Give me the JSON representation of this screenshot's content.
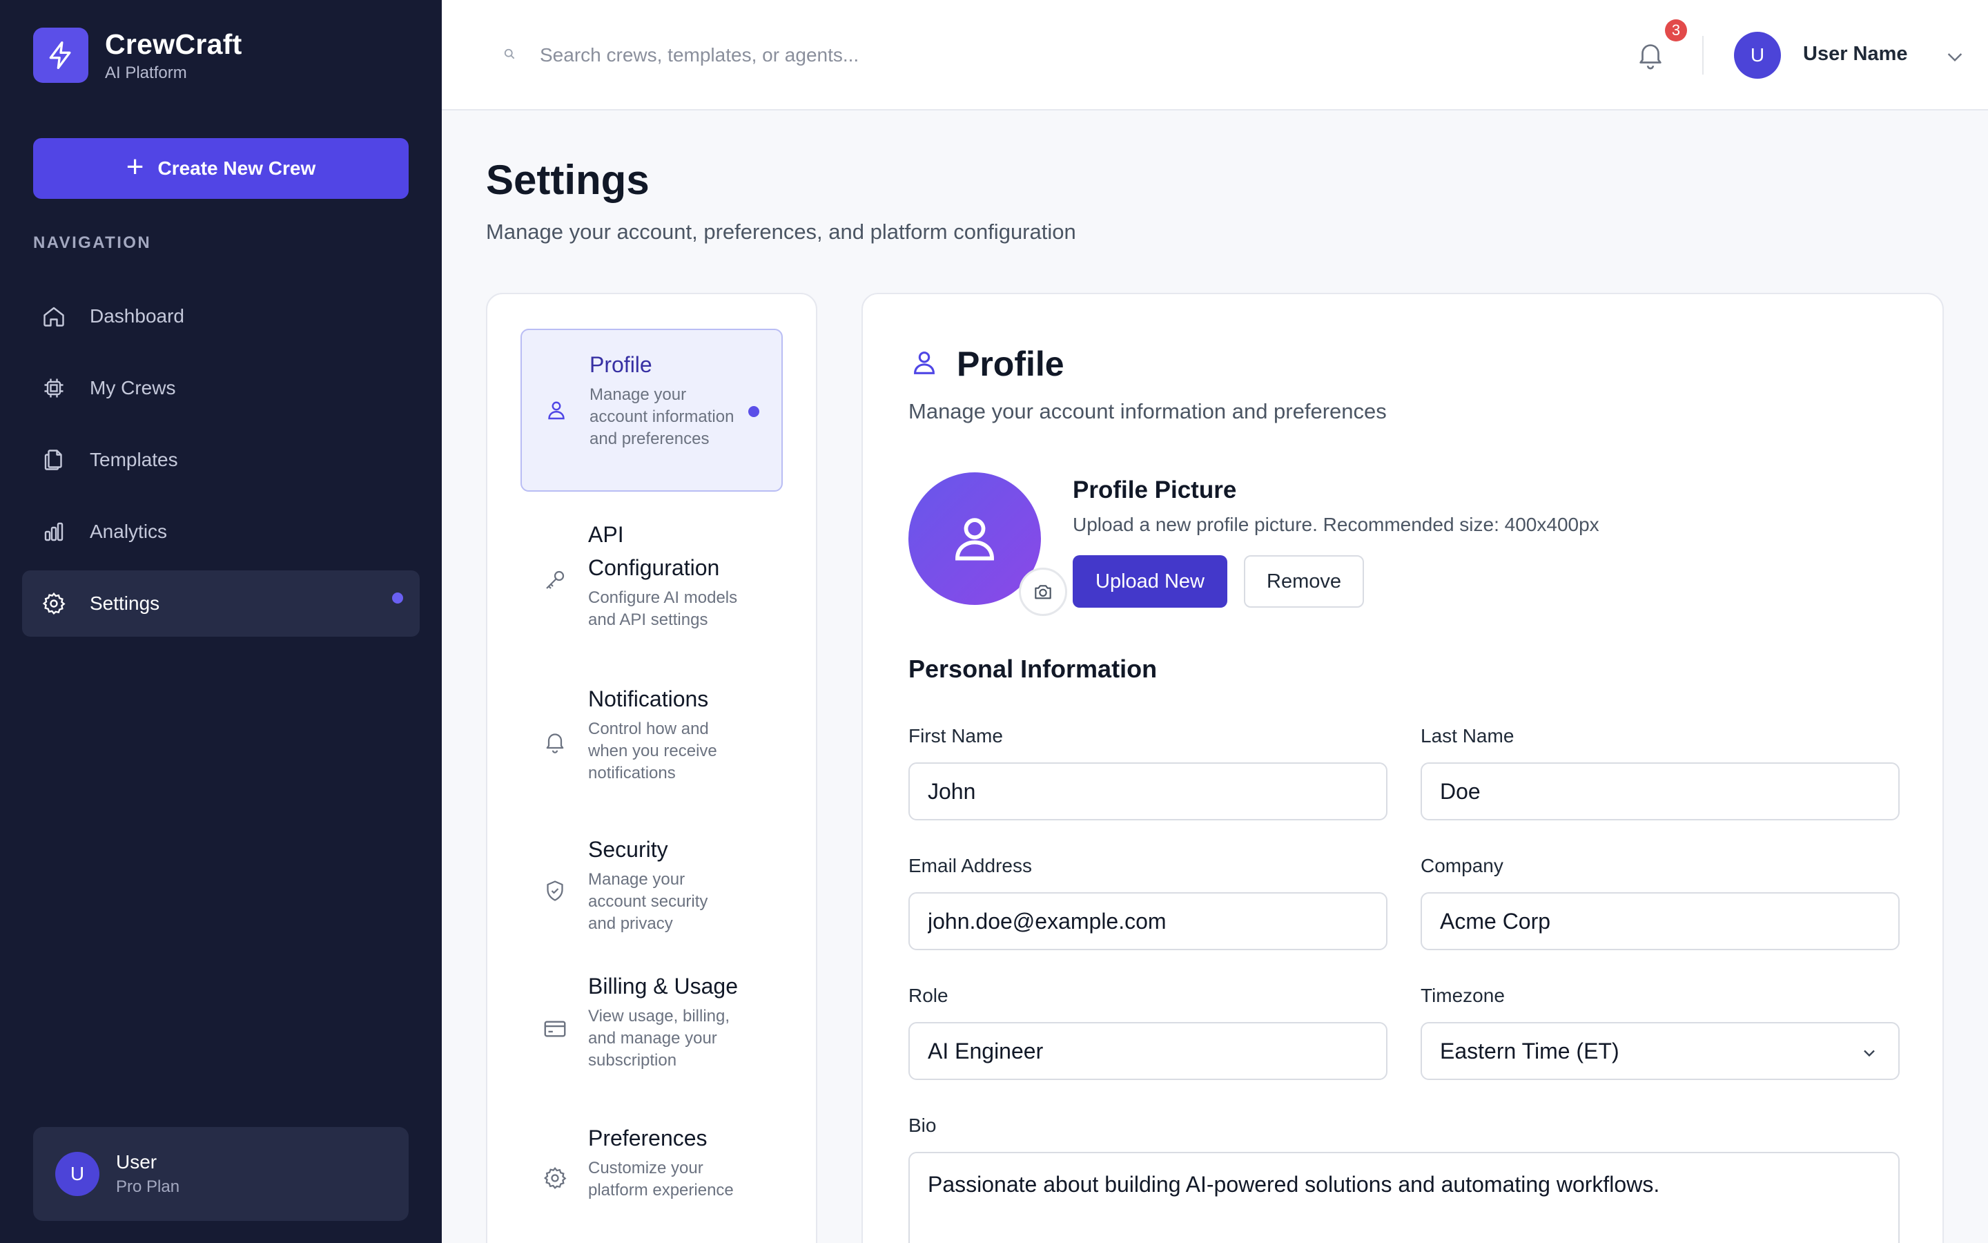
{
  "brand": {
    "name": "CrewCraft",
    "subtitle": "AI Platform"
  },
  "sidebar": {
    "create_button": "Create New Crew",
    "nav_heading": "NAVIGATION",
    "items": [
      {
        "label": "Dashboard",
        "icon": "home-icon"
      },
      {
        "label": "My Crews",
        "icon": "chip-icon"
      },
      {
        "label": "Templates",
        "icon": "copy-icon"
      },
      {
        "label": "Analytics",
        "icon": "bar-chart-icon"
      },
      {
        "label": "Settings",
        "icon": "gear-icon",
        "active": true
      }
    ],
    "user": {
      "initial": "U",
      "name": "User",
      "plan": "Pro Plan"
    }
  },
  "topbar": {
    "search_placeholder": "Search crews, templates, or agents...",
    "notification_count": "3",
    "user_initial": "U",
    "user_name": "User Name"
  },
  "page": {
    "title": "Settings",
    "subtitle": "Manage your account, preferences, and platform configuration"
  },
  "settings_menu": [
    {
      "title": "Profile",
      "desc": "Manage your account information and preferences",
      "icon": "user-icon",
      "active": true
    },
    {
      "title": "API Configuration",
      "desc": "Configure AI models and API settings",
      "icon": "key-icon"
    },
    {
      "title": "Notifications",
      "desc": "Control how and when you receive notifications",
      "icon": "bell-icon"
    },
    {
      "title": "Security",
      "desc": "Manage your account security and privacy",
      "icon": "shield-icon"
    },
    {
      "title": "Billing & Usage",
      "desc": "View usage, billing, and manage your subscription",
      "icon": "credit-card-icon"
    },
    {
      "title": "Preferences",
      "desc": "Customize your platform experience",
      "icon": "gear-icon"
    }
  ],
  "profile": {
    "title": "Profile",
    "subtitle": "Manage your account information and preferences",
    "picture_title": "Profile Picture",
    "picture_sub": "Upload a new profile picture. Recommended size: 400x400px",
    "upload_label": "Upload New",
    "remove_label": "Remove",
    "section_title": "Personal Information",
    "fields": {
      "first_name": {
        "label": "First Name",
        "value": "John"
      },
      "last_name": {
        "label": "Last Name",
        "value": "Doe"
      },
      "email": {
        "label": "Email Address",
        "value": "john.doe@example.com"
      },
      "company": {
        "label": "Company",
        "value": "Acme Corp"
      },
      "role": {
        "label": "Role",
        "value": "AI Engineer"
      },
      "timezone": {
        "label": "Timezone",
        "value": "Eastern Time (ET)"
      },
      "bio": {
        "label": "Bio",
        "value": "Passionate about building AI-powered solutions and automating workflows."
      }
    }
  },
  "colors": {
    "accent": "#5145e5",
    "sidebar_bg": "#161b33",
    "badge": "#e24a4a"
  }
}
